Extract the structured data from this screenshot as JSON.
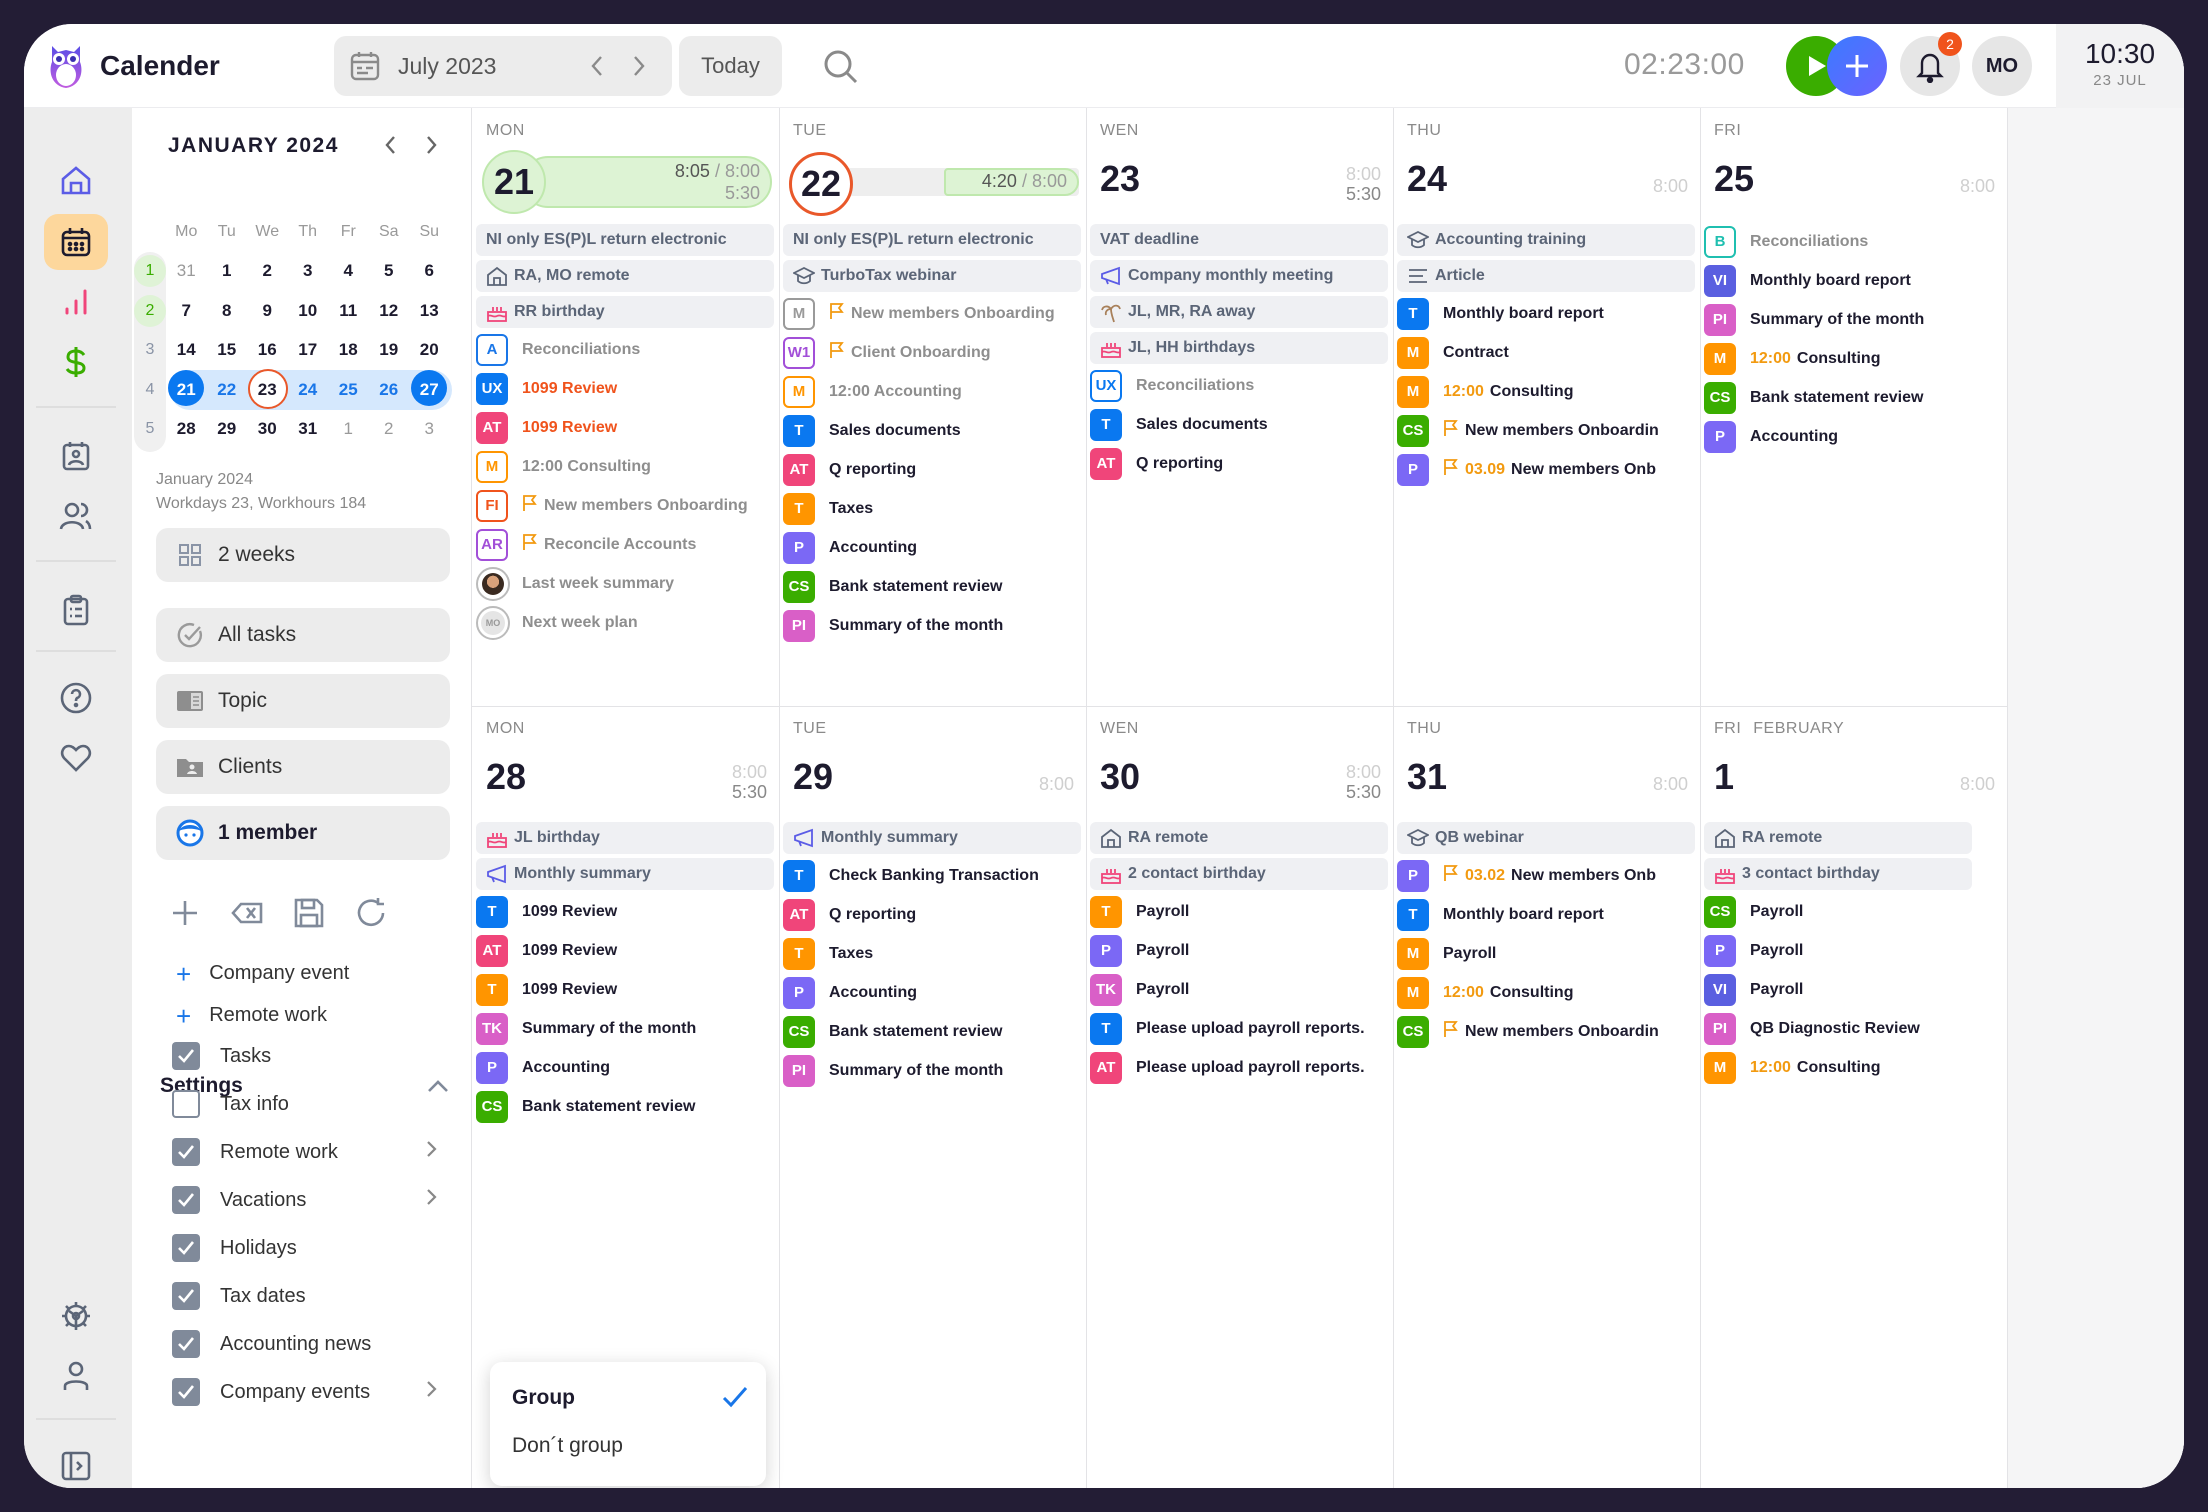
{
  "app": {
    "title": "Calender"
  },
  "header": {
    "month_label": "July 2023",
    "prev_label": "‹",
    "next_label": "›",
    "today_label": "Today",
    "timer": "02:23:00",
    "notifications_count": "2",
    "avatar_initials": "MO",
    "clock_time": "10:30",
    "clock_date": "23 JUL"
  },
  "rail": {
    "items": [
      {
        "name": "home",
        "icon": "home-icon"
      },
      {
        "name": "calendar",
        "icon": "calendar-icon",
        "active": true
      },
      {
        "name": "reports",
        "icon": "bar-chart-icon"
      },
      {
        "name": "billing",
        "icon": "dollar-icon"
      },
      {
        "name": "contacts",
        "icon": "contact-card-icon"
      },
      {
        "name": "team",
        "icon": "users-icon"
      },
      {
        "name": "tasks",
        "icon": "clipboard-icon"
      },
      {
        "name": "help",
        "icon": "help-icon"
      },
      {
        "name": "favorites",
        "icon": "heart-icon"
      },
      {
        "name": "settings",
        "icon": "gear-icon"
      },
      {
        "name": "profile",
        "icon": "user-icon"
      },
      {
        "name": "collapse",
        "icon": "sidebar-expand-icon"
      }
    ]
  },
  "mini_calendar": {
    "title": "JANUARY 2024",
    "weekday_headers": [
      "Mo",
      "Tu",
      "We",
      "Th",
      "Fr",
      "Sa",
      "Su"
    ],
    "weeks": [
      {
        "week": "1",
        "days": [
          "31",
          "1",
          "2",
          "3",
          "4",
          "5",
          "6"
        ]
      },
      {
        "week": "2",
        "days": [
          "7",
          "8",
          "9",
          "10",
          "11",
          "12",
          "13"
        ]
      },
      {
        "week": "3",
        "days": [
          "14",
          "15",
          "16",
          "17",
          "18",
          "19",
          "20"
        ]
      },
      {
        "week": "4",
        "days": [
          "21",
          "22",
          "23",
          "24",
          "25",
          "26",
          "27"
        ]
      },
      {
        "week": "5",
        "days": [
          "28",
          "29",
          "30",
          "31",
          "1",
          "2",
          "3"
        ]
      }
    ],
    "info_month": "January 2024",
    "info_stats": "Workdays 23, Workhours 184"
  },
  "side": {
    "view_label": "2 weeks",
    "filters": [
      {
        "label": "All tasks",
        "icon": "check-circle-icon"
      },
      {
        "label": "Topic",
        "icon": "topic-icon"
      },
      {
        "label": "Clients",
        "icon": "client-folder-icon"
      },
      {
        "label": "1 member",
        "icon": "member-face-icon"
      }
    ],
    "add_links": [
      "Company event",
      "Remote work"
    ],
    "settings_title": "Settings",
    "settings": [
      {
        "label": "Tasks",
        "checked": true,
        "has_submenu": false
      },
      {
        "label": "Tax info",
        "checked": false,
        "has_submenu": false
      },
      {
        "label": "Remote work",
        "checked": true,
        "has_submenu": true
      },
      {
        "label": "Vacations",
        "checked": true,
        "has_submenu": true
      },
      {
        "label": "Holidays",
        "checked": true,
        "has_submenu": false
      },
      {
        "label": "Tax dates",
        "checked": true,
        "has_submenu": false
      },
      {
        "label": "Accounting news",
        "checked": true,
        "has_submenu": false
      },
      {
        "label": "Company events",
        "checked": true,
        "has_submenu": true
      }
    ]
  },
  "popup": {
    "options": [
      {
        "label": "Group",
        "selected": true
      },
      {
        "label": "Don´t group",
        "selected": false
      }
    ]
  },
  "colors": {
    "T_blue": "#0a78f0",
    "AT_pink": "#f0457a",
    "T_orange": "#ff9500",
    "P_purple": "#7b68f5",
    "CS_green": "#3aad00",
    "PI_magenta": "#d95fc7",
    "TK_magenta": "#d95fc7",
    "VI_indigo": "#5a5fe0",
    "accent_orange": "#f29a10",
    "today_ring": "#e9582a"
  },
  "weeks": [
    {
      "days": [
        {
          "dayname": "MON",
          "num": "21",
          "progress": {
            "worked": "8:05",
            "target": "8:00",
            "extra": "5:30",
            "fraction": 1.0
          },
          "events": [
            {
              "icon": "",
              "text": "NI only ES(P)L return electronic"
            },
            {
              "icon": "home",
              "text": "RA, MO remote"
            },
            {
              "icon": "cake",
              "text": "RR birthday"
            }
          ],
          "tasks": [
            {
              "badge": "A",
              "color": "#1976e8",
              "outline": true,
              "text": "Reconciliations",
              "muted": true
            },
            {
              "badge": "UX",
              "color": "#0a78f0",
              "text": "1099 Review",
              "red": true
            },
            {
              "badge": "AT",
              "color": "#f0457a",
              "text": "1099 Review",
              "red": true
            },
            {
              "badge": "M",
              "color": "#ff9500",
              "outline": true,
              "text": "12:00 Consulting",
              "muted": true
            },
            {
              "badge": "FI",
              "color": "#f0531c",
              "outline": true,
              "flag": true,
              "text": "New members Onboarding",
              "muted": true
            },
            {
              "badge": "AR",
              "color": "#a24fd8",
              "outline": true,
              "flag": true,
              "text": "Reconcile Accounts",
              "muted": true
            },
            {
              "avatar": "photo",
              "text": "Last week summary",
              "muted": true
            },
            {
              "avatar": "MO",
              "text": "Next week plan",
              "muted": true
            }
          ]
        },
        {
          "dayname": "TUE",
          "num": "22",
          "today": true,
          "progress": {
            "worked": "4:20",
            "target": "8:00",
            "fraction": 0.54
          },
          "events": [
            {
              "icon": "",
              "text": "NI only ES(P)L return electronic"
            },
            {
              "icon": "cap",
              "text": "TurboTax webinar"
            }
          ],
          "tasks": [
            {
              "badge": "M",
              "color": "#9a9a9a",
              "outline": true,
              "flag": true,
              "text": "New members Onboarding",
              "muted": true
            },
            {
              "badge": "W1",
              "color": "#a24fd8",
              "outline": true,
              "flag": true,
              "text": "Client Onboarding",
              "muted": true
            },
            {
              "badge": "M",
              "color": "#ff9500",
              "outline": true,
              "text": "12:00 Accounting",
              "muted": true
            },
            {
              "badge": "T",
              "color": "#0a78f0",
              "text": "Sales documents"
            },
            {
              "badge": "AT",
              "color": "#f0457a",
              "text": "Q reporting"
            },
            {
              "badge": "T",
              "color": "#ff9500",
              "text": "Taxes"
            },
            {
              "badge": "P",
              "color": "#7b68f5",
              "text": "Accounting"
            },
            {
              "badge": "CS",
              "color": "#3aad00",
              "text": "Bank statement review"
            },
            {
              "badge": "PI",
              "color": "#d95fc7",
              "text": "Summary of the month"
            }
          ]
        },
        {
          "dayname": "WEN",
          "num": "23",
          "hours": [
            "8:00",
            "5:30"
          ],
          "events": [
            {
              "icon": "",
              "text": "VAT deadline"
            },
            {
              "icon": "megaphone",
              "text": "Company monthly meeting"
            },
            {
              "icon": "palm",
              "text": "JL, MR, RA away"
            },
            {
              "icon": "cake",
              "text": "JL, HH birthdays"
            }
          ],
          "tasks": [
            {
              "badge": "UX",
              "color": "#0a78f0",
              "outline": true,
              "text": "Reconciliations",
              "muted": true
            },
            {
              "badge": "T",
              "color": "#0a78f0",
              "text": "Sales documents"
            },
            {
              "badge": "AT",
              "color": "#f0457a",
              "text": "Q reporting"
            }
          ]
        },
        {
          "dayname": "THU",
          "num": "24",
          "hours": [
            "8:00"
          ],
          "events": [
            {
              "icon": "cap",
              "text": "Accounting training"
            },
            {
              "icon": "lines",
              "text": "Article"
            }
          ],
          "tasks": [
            {
              "badge": "T",
              "color": "#0a78f0",
              "text": "Monthly board report"
            },
            {
              "badge": "M",
              "color": "#ff9500",
              "text": "Contract"
            },
            {
              "badge": "M",
              "color": "#ff9500",
              "time": "12:00",
              "text": "Consulting"
            },
            {
              "badge": "CS",
              "color": "#3aad00",
              "flag": true,
              "text": "New members Onboardin"
            },
            {
              "badge": "P",
              "color": "#7b68f5",
              "flag": true,
              "time": "03.09",
              "text": "New members Onb"
            }
          ]
        },
        {
          "dayname": "FRI",
          "num": "25",
          "hours": [
            "8:00"
          ],
          "events": [],
          "tasks": [
            {
              "badge": "B",
              "color": "#1fbfb0",
              "outline": true,
              "text": "Reconciliations",
              "muted": true
            },
            {
              "badge": "VI",
              "color": "#5a5fe0",
              "text": "Monthly board report"
            },
            {
              "badge": "PI",
              "color": "#d95fc7",
              "text": "Summary of the month"
            },
            {
              "badge": "M",
              "color": "#ff9500",
              "time": "12:00",
              "text": "Consulting"
            },
            {
              "badge": "CS",
              "color": "#3aad00",
              "text": "Bank statement review"
            },
            {
              "badge": "P",
              "color": "#7b68f5",
              "text": "Accounting"
            }
          ]
        }
      ]
    },
    {
      "days": [
        {
          "dayname": "MON",
          "num": "28",
          "hours": [
            "8:00",
            "5:30"
          ],
          "events": [
            {
              "icon": "cake",
              "text": "JL birthday"
            },
            {
              "icon": "megaphone",
              "text": "Monthly summary"
            }
          ],
          "tasks": [
            {
              "badge": "T",
              "color": "#0a78f0",
              "text": "1099 Review"
            },
            {
              "badge": "AT",
              "color": "#f0457a",
              "text": "1099 Review"
            },
            {
              "badge": "T",
              "color": "#ff9500",
              "text": "1099 Review"
            },
            {
              "badge": "TK",
              "color": "#d95fc7",
              "text": "Summary of the month"
            },
            {
              "badge": "P",
              "color": "#7b68f5",
              "text": "Accounting"
            },
            {
              "badge": "CS",
              "color": "#3aad00",
              "text": "Bank statement review"
            }
          ]
        },
        {
          "dayname": "TUE",
          "num": "29",
          "hours": [
            "8:00"
          ],
          "events": [
            {
              "icon": "megaphone",
              "text": "Monthly summary"
            }
          ],
          "tasks": [
            {
              "badge": "T",
              "color": "#0a78f0",
              "text": "Check Banking Transaction"
            },
            {
              "badge": "AT",
              "color": "#f0457a",
              "text": "Q reporting"
            },
            {
              "badge": "T",
              "color": "#ff9500",
              "text": "Taxes"
            },
            {
              "badge": "P",
              "color": "#7b68f5",
              "text": "Accounting"
            },
            {
              "badge": "CS",
              "color": "#3aad00",
              "text": "Bank statement review"
            },
            {
              "badge": "PI",
              "color": "#d95fc7",
              "text": "Summary of the month"
            }
          ]
        },
        {
          "dayname": "WEN",
          "num": "30",
          "hours": [
            "8:00",
            "5:30"
          ],
          "events": [
            {
              "icon": "home",
              "text": "RA remote"
            },
            {
              "icon": "cake",
              "text": "2 contact birthday"
            }
          ],
          "tasks": [
            {
              "badge": "T",
              "color": "#ff9500",
              "text": "Payroll"
            },
            {
              "badge": "P",
              "color": "#7b68f5",
              "text": "Payroll"
            },
            {
              "badge": "TK",
              "color": "#d95fc7",
              "text": "Payroll"
            },
            {
              "badge": "T",
              "color": "#0a78f0",
              "text": "Please upload payroll reports."
            },
            {
              "badge": "AT",
              "color": "#f0457a",
              "text": "Please upload payroll reports."
            }
          ]
        },
        {
          "dayname": "THU",
          "num": "31",
          "hours": [
            "8:00"
          ],
          "events": [
            {
              "icon": "cap",
              "text": "QB webinar"
            }
          ],
          "tasks": [
            {
              "badge": "P",
              "color": "#7b68f5",
              "flag": true,
              "time": "03.02",
              "text": "New members Onb"
            },
            {
              "badge": "T",
              "color": "#0a78f0",
              "text": "Monthly board report"
            },
            {
              "badge": "M",
              "color": "#ff9500",
              "text": "Payroll"
            },
            {
              "badge": "M",
              "color": "#ff9500",
              "time": "12:00",
              "text": "Consulting"
            },
            {
              "badge": "CS",
              "color": "#3aad00",
              "flag": true,
              "text": "New members Onboardin"
            }
          ]
        },
        {
          "dayname": "FRI",
          "month": "FEBRUARY",
          "num": "1",
          "hours": [
            "8:00"
          ],
          "events": [
            {
              "icon": "home",
              "text": "RA remote"
            },
            {
              "icon": "cake",
              "text": "3 contact birthday"
            }
          ],
          "tasks": [
            {
              "badge": "CS",
              "color": "#3aad00",
              "text": "Payroll"
            },
            {
              "badge": "P",
              "color": "#7b68f5",
              "text": "Payroll"
            },
            {
              "badge": "VI",
              "color": "#5a5fe0",
              "text": "Payroll"
            },
            {
              "badge": "PI",
              "color": "#d95fc7",
              "text": "QB Diagnostic Review"
            },
            {
              "badge": "M",
              "color": "#ff9500",
              "time": "12:00",
              "text": "Consulting"
            }
          ]
        }
      ]
    }
  ]
}
